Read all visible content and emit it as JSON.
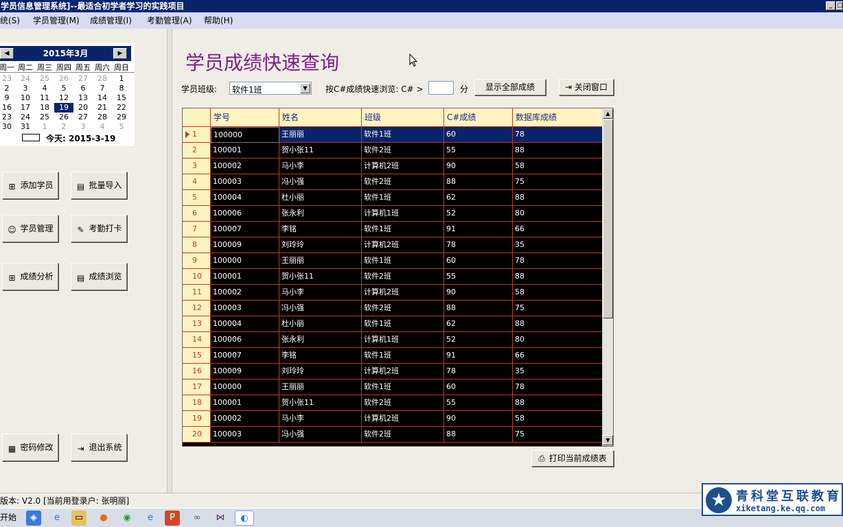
{
  "window": {
    "title": "学员信息管理系统]--最适合初学者学习的实践项目"
  },
  "menu": [
    {
      "label": "统(S)"
    },
    {
      "label": "学员管理(M)"
    },
    {
      "label": "成绩管理(I)"
    },
    {
      "label": "考勤管理(A)"
    },
    {
      "label": "帮助(H)"
    }
  ],
  "calendar": {
    "month_label": "2015年3月",
    "prev": "◀",
    "next": "▶",
    "weekdays": [
      "周一",
      "周二",
      "周三",
      "周四",
      "周五",
      "周六",
      "周日"
    ],
    "weeks": [
      [
        "23",
        "24",
        "25",
        "26",
        "27",
        "28",
        "1"
      ],
      [
        "2",
        "3",
        "4",
        "5",
        "6",
        "7",
        "8"
      ],
      [
        "9",
        "10",
        "11",
        "12",
        "13",
        "14",
        "15"
      ],
      [
        "16",
        "17",
        "18",
        "19",
        "20",
        "21",
        "22"
      ],
      [
        "23",
        "24",
        "25",
        "26",
        "27",
        "28",
        "29"
      ],
      [
        "30",
        "31",
        "1",
        "2",
        "3",
        "4",
        "5"
      ]
    ],
    "today_label": "今天: 2015-3-19",
    "selected": "19"
  },
  "left_buttons": {
    "add": "添加学员",
    "import": "批量导入",
    "manage": "学员管理",
    "attendance": "考勤打卡",
    "analysis": "成绩分析",
    "browse": "成绩浏览",
    "password": "密码修改",
    "exit": "退出系统"
  },
  "page": {
    "title": "学员成绩快速查询",
    "class_label": "学员班级:",
    "class_value": "软件1班",
    "filter_label": "按C#成绩快速浏览: C# >",
    "score_value": "",
    "score_unit": "分",
    "show_all": "显示全部成绩",
    "close": "关闭窗口",
    "print": "打印当前成绩表"
  },
  "grid": {
    "columns": [
      "学号",
      "姓名",
      "班级",
      "C#成绩",
      "数据库成绩"
    ],
    "rows": [
      {
        "n": "1",
        "id": "100000",
        "name": "王丽丽",
        "cls": "软件1班",
        "cs": "60",
        "db": "78"
      },
      {
        "n": "2",
        "id": "100001",
        "name": "贺小张11",
        "cls": "软件2班",
        "cs": "55",
        "db": "88"
      },
      {
        "n": "3",
        "id": "100002",
        "name": "马小李",
        "cls": "计算机2班",
        "cs": "90",
        "db": "58"
      },
      {
        "n": "4",
        "id": "100003",
        "name": "冯小强",
        "cls": "软件2班",
        "cs": "88",
        "db": "75"
      },
      {
        "n": "5",
        "id": "100004",
        "name": "杜小丽",
        "cls": "软件1班",
        "cs": "62",
        "db": "88"
      },
      {
        "n": "6",
        "id": "100006",
        "name": "张永利",
        "cls": "计算机1班",
        "cs": "52",
        "db": "80"
      },
      {
        "n": "7",
        "id": "100007",
        "name": "李铭",
        "cls": "软件1班",
        "cs": "91",
        "db": "66"
      },
      {
        "n": "8",
        "id": "100009",
        "name": "刘玲玲",
        "cls": "计算机2班",
        "cs": "78",
        "db": "35"
      },
      {
        "n": "9",
        "id": "100000",
        "name": "王丽丽",
        "cls": "软件1班",
        "cs": "60",
        "db": "78"
      },
      {
        "n": "10",
        "id": "100001",
        "name": "贺小张11",
        "cls": "软件2班",
        "cs": "55",
        "db": "88"
      },
      {
        "n": "11",
        "id": "100002",
        "name": "马小李",
        "cls": "计算机2班",
        "cs": "90",
        "db": "58"
      },
      {
        "n": "12",
        "id": "100003",
        "name": "冯小强",
        "cls": "软件2班",
        "cs": "88",
        "db": "75"
      },
      {
        "n": "13",
        "id": "100004",
        "name": "杜小丽",
        "cls": "软件1班",
        "cs": "62",
        "db": "88"
      },
      {
        "n": "14",
        "id": "100006",
        "name": "张永利",
        "cls": "计算机1班",
        "cs": "52",
        "db": "80"
      },
      {
        "n": "15",
        "id": "100007",
        "name": "李铭",
        "cls": "软件1班",
        "cs": "91",
        "db": "66"
      },
      {
        "n": "16",
        "id": "100009",
        "name": "刘玲玲",
        "cls": "计算机2班",
        "cs": "78",
        "db": "35"
      },
      {
        "n": "17",
        "id": "100000",
        "name": "王丽丽",
        "cls": "软件1班",
        "cs": "60",
        "db": "78"
      },
      {
        "n": "18",
        "id": "100001",
        "name": "贺小张11",
        "cls": "软件2班",
        "cs": "55",
        "db": "88"
      },
      {
        "n": "19",
        "id": "100002",
        "name": "马小李",
        "cls": "计算机2班",
        "cs": "90",
        "db": "58"
      },
      {
        "n": "20",
        "id": "100003",
        "name": "冯小强",
        "cls": "软件2班",
        "cs": "88",
        "db": "75"
      }
    ]
  },
  "status": {
    "text": "版本: V2.0  [当前用登录户: 张明丽]"
  },
  "taskbar": {
    "start": "开始"
  },
  "logo": {
    "name": "青科堂互联教育",
    "url": "xiketang.ke.qq.com"
  },
  "colors": {
    "title_bar": "#0a246a",
    "page_title": "#7a1f8c",
    "grid_bg": "#000000",
    "grid_lines": "#c0392b",
    "header_bg": "#fff3c0"
  }
}
